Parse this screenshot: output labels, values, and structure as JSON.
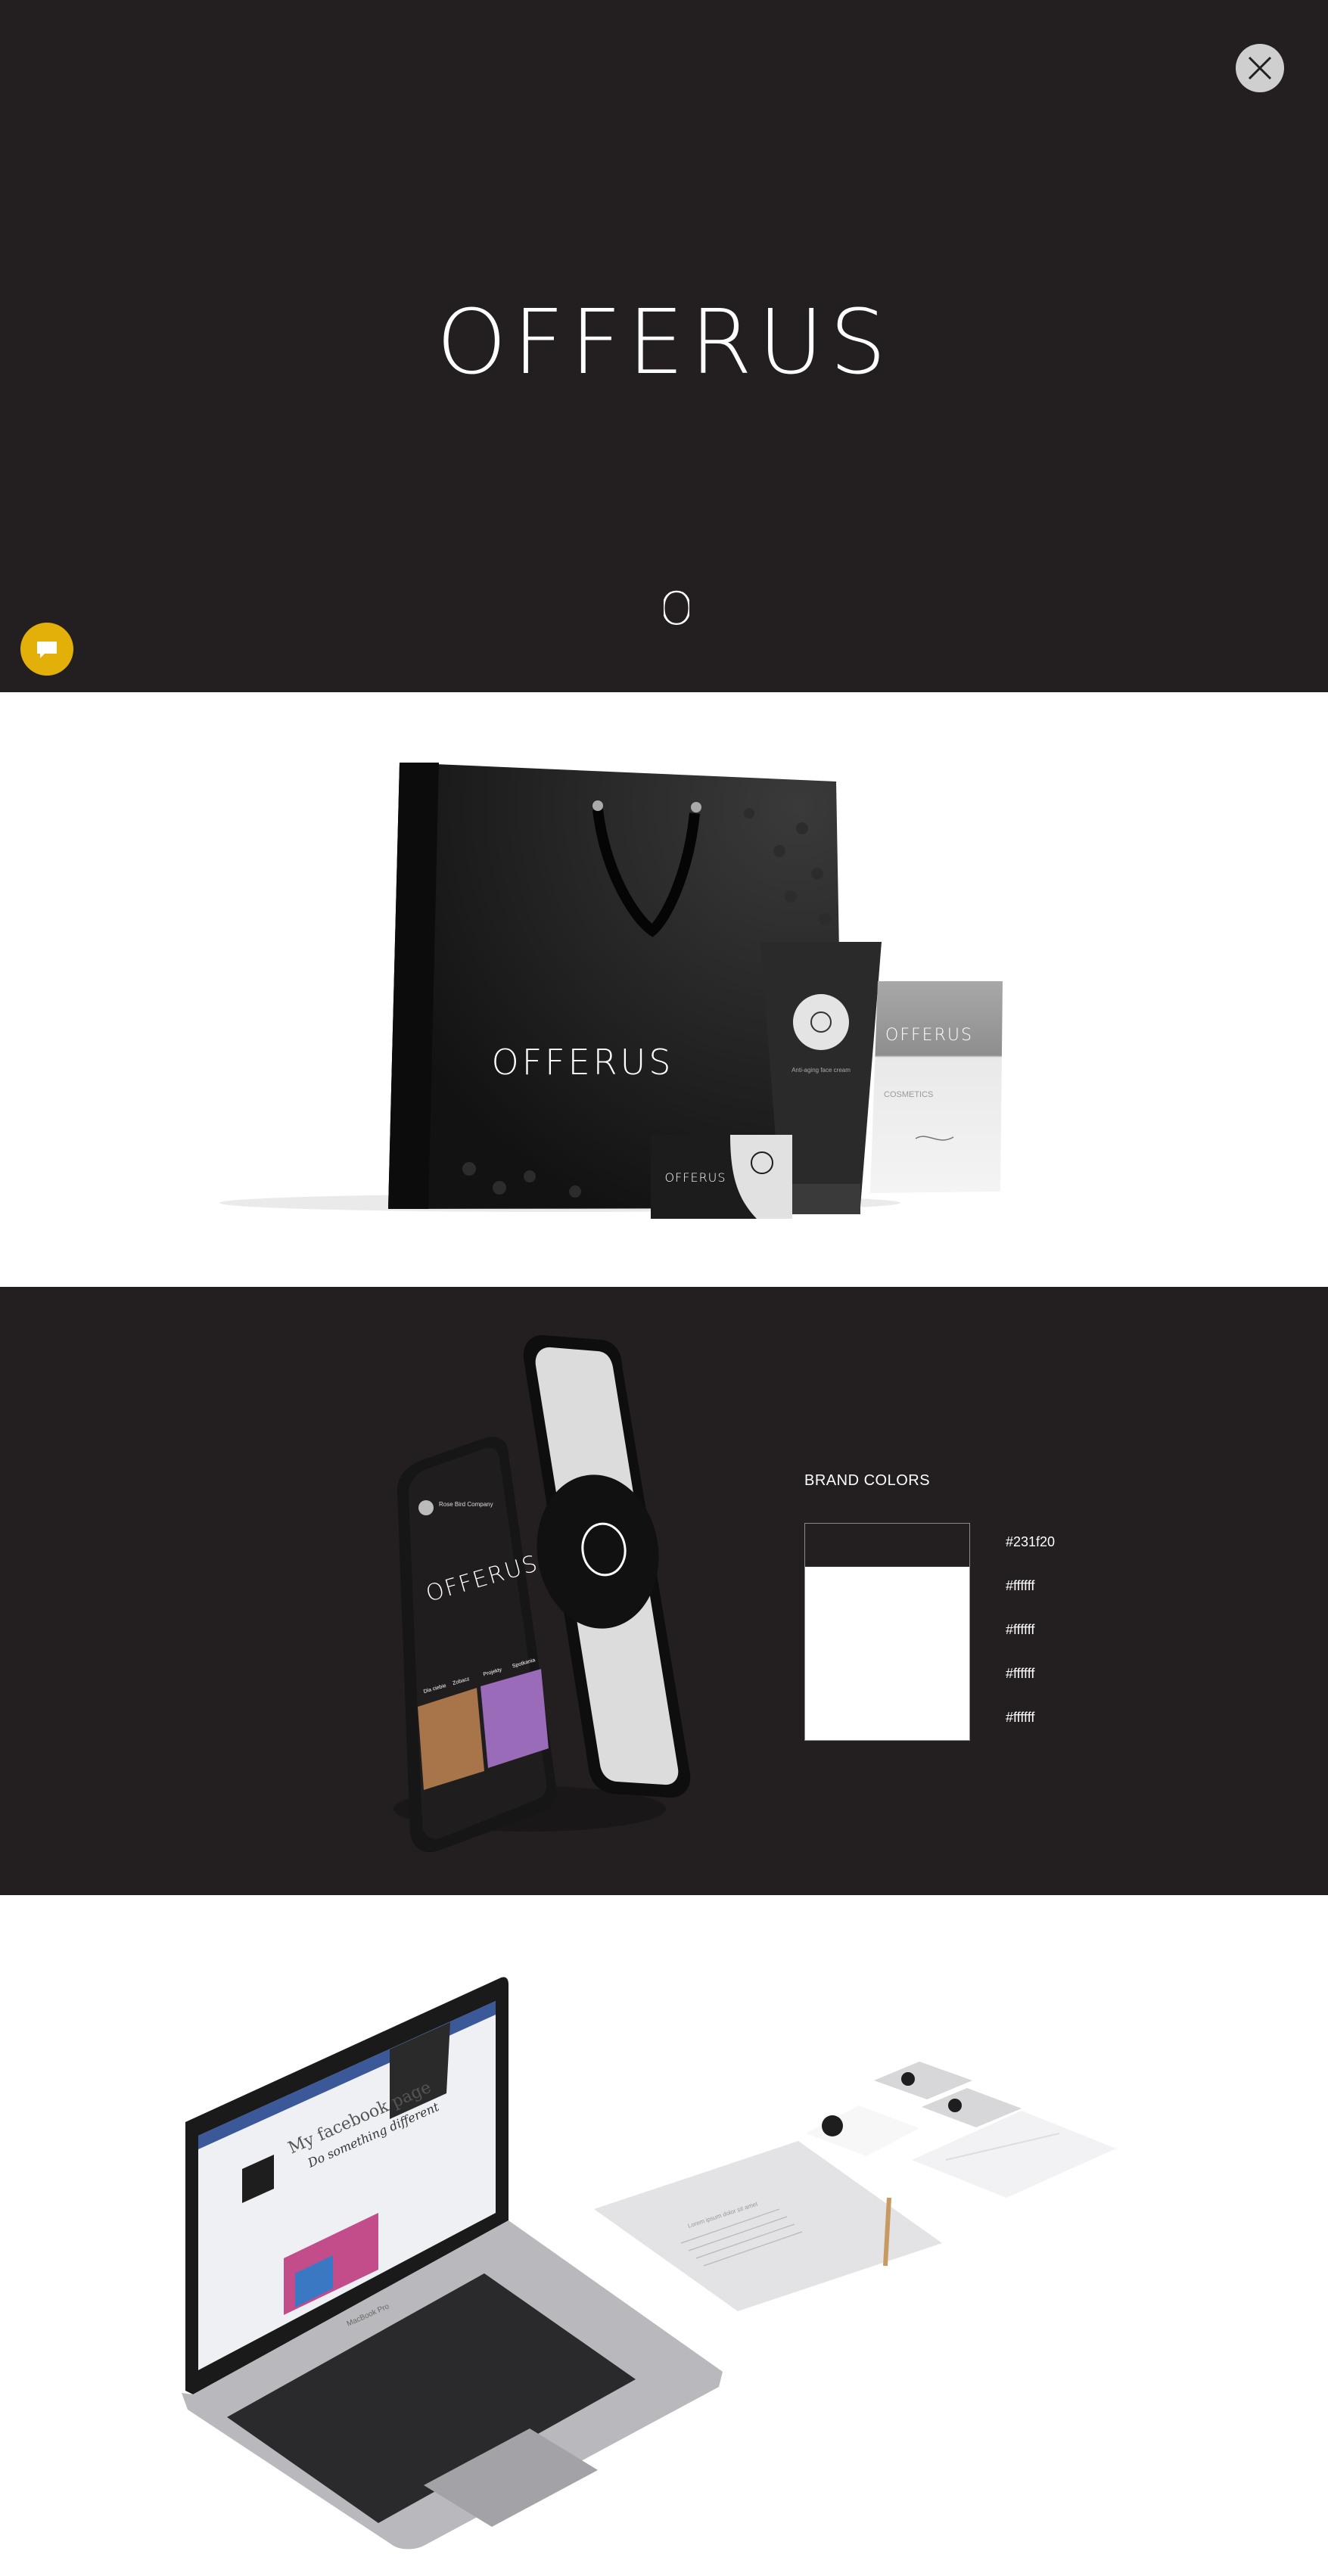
{
  "hero": {
    "logo_text": "OFFERUS",
    "mark_text": "O",
    "background": "#231f20",
    "close_icon": "close-icon",
    "chat_icon": "chat-icon",
    "chat_color": "#e3b009"
  },
  "packaging": {
    "bag_logo": "OFFERUS",
    "card_logo": "OFFERUS",
    "tube_text_1": "Anti-aging face cream",
    "pouch_logo": "OFFERUS",
    "pouch_label": "COSMETICS"
  },
  "phone": {
    "profile_name": "Rose Bird Company",
    "logo": "OFFERUS",
    "tabs": [
      "Dla ciebie",
      "Zobacz",
      "Projekty",
      "Spotkania"
    ]
  },
  "brand_colors": {
    "title": "BRAND COLORS",
    "swatches": [
      {
        "hex": "#231f20",
        "label": "#231f20"
      },
      {
        "hex": "#ffffff",
        "label": "#ffffff"
      },
      {
        "hex": "#ffffff",
        "label": "#ffffff"
      },
      {
        "hex": "#ffffff",
        "label": "#ffffff"
      },
      {
        "hex": "#ffffff",
        "label": "#ffffff"
      }
    ]
  },
  "laptop": {
    "fb_title": "My facebook page",
    "fb_subtitle": "Do something different",
    "brand_name": "MacBook Pro"
  },
  "stationery": {
    "letter_text": "Lorem ipsum dolor sit amet"
  }
}
